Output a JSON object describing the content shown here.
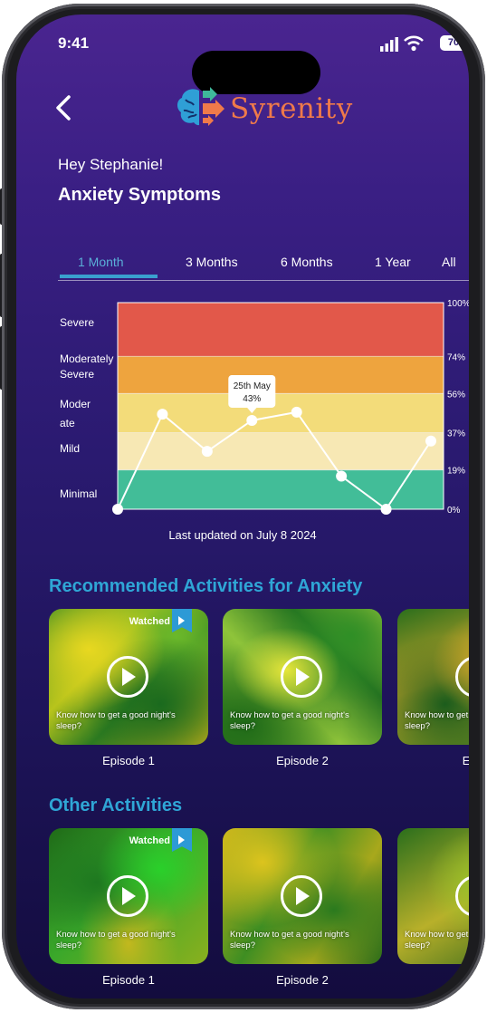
{
  "status": {
    "time": "9:41",
    "battery": "70"
  },
  "header": {
    "app_name": "Syrenity"
  },
  "greeting": "Hey Stephanie!",
  "heading": "Anxiety Symptoms",
  "tabs": [
    "1 Month",
    "3 Months",
    "6 Months",
    "1 Year",
    "All"
  ],
  "active_tab": "1 Month",
  "chart_data": {
    "type": "line",
    "bands": [
      {
        "label": "Severe",
        "from": 74,
        "to": 100,
        "color": "#e2584a"
      },
      {
        "label": "Moderately Severe",
        "from": 56,
        "to": 74,
        "color": "#eea43e"
      },
      {
        "label": "Moderate",
        "from": 37,
        "to": 56,
        "color": "#f3dc7a"
      },
      {
        "label": "Mild",
        "from": 19,
        "to": 37,
        "color": "#f7e8b4"
      },
      {
        "label": "Minimal",
        "from": 0,
        "to": 19,
        "color": "#42bd98"
      }
    ],
    "band_labels": [
      "Severe",
      "Moderately",
      "Severe",
      "Moder",
      "ate",
      "Mild",
      "Minimal"
    ],
    "y_ticks": [
      "100%",
      "74%",
      "56%",
      "37%",
      "19%",
      "0%"
    ],
    "y_tick_values": [
      100,
      74,
      56,
      37,
      19,
      0
    ],
    "ylim": [
      0,
      100
    ],
    "values": [
      0,
      46,
      28,
      43,
      47,
      16,
      0,
      33
    ],
    "tooltip": {
      "date": "25th May",
      "value": "43%",
      "point_index": 3
    }
  },
  "last_updated": "Last updated on July 8 2024",
  "recommended": {
    "title": "Recommended Activities for Anxiety",
    "cards": [
      {
        "episode": "Episode 1",
        "desc": "Know how to get a good night's sleep?",
        "watched": "Watched"
      },
      {
        "episode": "Episode 2",
        "desc": "Know how to get a good night's sleep?",
        "watched": ""
      },
      {
        "episode": "Episo",
        "desc": "Know how to get a good night's sleep?",
        "watched": ""
      }
    ]
  },
  "other": {
    "title": "Other Activities",
    "cards": [
      {
        "episode": "Episode 1",
        "desc": "Know how to get a good night's sleep?",
        "watched": "Watched"
      },
      {
        "episode": "Episode 2",
        "desc": "Know how to get a good night's sleep?",
        "watched": ""
      },
      {
        "episode": "Ep",
        "desc": "Know how to get a good night's sleep?",
        "watched": ""
      }
    ]
  },
  "colors": {
    "accent": "#2fa6d6",
    "brand": "#ef7a4a",
    "background": "#2a1a70"
  },
  "icons": [
    "back-chevron-icon",
    "brain-logo-icon",
    "signal-icon",
    "wifi-icon",
    "battery-icon",
    "play-icon",
    "bookmark-play-icon"
  ]
}
